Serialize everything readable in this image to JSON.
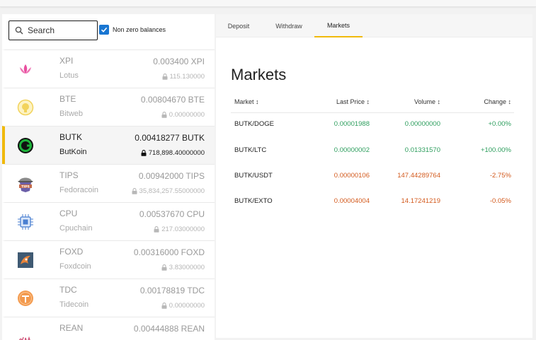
{
  "search": {
    "placeholder": "Search"
  },
  "non_zero_label": "Non zero balances",
  "coins": [
    {
      "symbol": "XPI",
      "name": "Lotus",
      "price": "0.003400 XPI",
      "balance": "115.130000",
      "icon": "lotus-icon",
      "color": "#e94fa0"
    },
    {
      "symbol": "BTE",
      "name": "Bitweb",
      "price": "0.00804670 BTE",
      "balance": "0.00000000",
      "icon": "bitweb-icon",
      "color": "#f2d35c"
    },
    {
      "symbol": "BUTK",
      "name": "ButKoin",
      "price": "0.00418277 BUTK",
      "balance": "718,898.40000000",
      "icon": "butkoin-icon",
      "color": "#1db33a"
    },
    {
      "symbol": "TIPS",
      "name": "Fedoracoin",
      "price": "0.00942000 TIPS",
      "balance": "35,834,257.55000000",
      "icon": "fedoracoin-icon",
      "color": "#6b5fa8"
    },
    {
      "symbol": "CPU",
      "name": "Cpuchain",
      "price": "0.00537670 CPU",
      "balance": "217.03000000",
      "icon": "cpu-chip-icon",
      "color": "#4a7fd1"
    },
    {
      "symbol": "FOXD",
      "name": "Foxdcoin",
      "price": "0.00316000 FOXD",
      "balance": "3.83000000",
      "icon": "foxdcoin-icon",
      "color": "#3f5a73"
    },
    {
      "symbol": "TDC",
      "name": "Tidecoin",
      "price": "0.00178819 TDC",
      "balance": "0.00000000",
      "icon": "tidecoin-icon",
      "color": "#f39a4e"
    },
    {
      "symbol": "REAN",
      "name": "",
      "price": "0.00444888 REAN",
      "balance": "",
      "icon": "rean-logo-icon",
      "color": "#d0567a"
    }
  ],
  "tabs": [
    "Deposit",
    "Withdraw",
    "Markets"
  ],
  "markets": {
    "title": "Markets",
    "headers": [
      "Market ↕",
      "Last Price ↕",
      "Volume ↕",
      "Change ↕"
    ],
    "rows": [
      {
        "market": "BUTK/DOGE",
        "price": "0.00001988",
        "volume": "0.00000000",
        "change": "+0.00%",
        "trend": "up"
      },
      {
        "market": "BUTK/LTC",
        "price": "0.00000002",
        "volume": "0.01331570",
        "change": "+100.00%",
        "trend": "up"
      },
      {
        "market": "BUTK/USDT",
        "price": "0.00000106",
        "volume": "147.44289764",
        "change": "-2.75%",
        "trend": "down"
      },
      {
        "market": "BUTK/EXTO",
        "price": "0.00004004",
        "volume": "14.17241219",
        "change": "-0.05%",
        "trend": "down"
      }
    ]
  }
}
